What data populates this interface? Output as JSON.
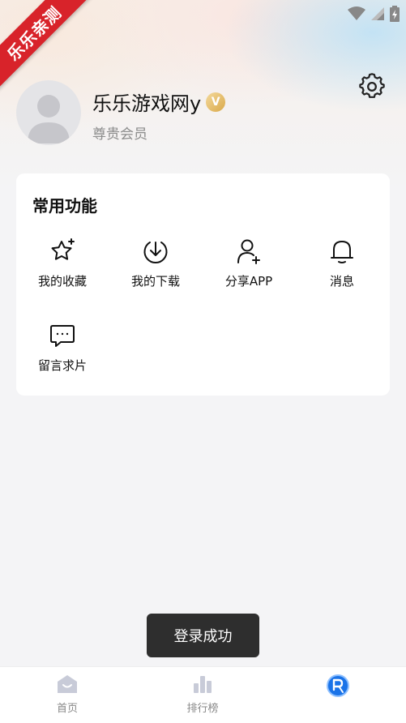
{
  "ribbon": {
    "text": "乐乐亲测"
  },
  "profile": {
    "username": "乐乐游戏网y",
    "member_level": "尊贵会员",
    "vip_badge": "V"
  },
  "functions": {
    "title": "常用功能",
    "items": [
      {
        "label": "我的收藏",
        "icon": "star-plus-icon"
      },
      {
        "label": "我的下载",
        "icon": "download-icon"
      },
      {
        "label": "分享APP",
        "icon": "add-user-icon"
      },
      {
        "label": "消息",
        "icon": "bell-icon"
      },
      {
        "label": "留言求片",
        "icon": "message-icon"
      }
    ]
  },
  "toast": {
    "text": "登录成功"
  },
  "tabbar": {
    "items": [
      {
        "label": "首页",
        "icon": "home-icon"
      },
      {
        "label": "排行榜",
        "icon": "chart-bar-icon"
      },
      {
        "label": "",
        "icon": "profile-logo-icon"
      }
    ],
    "accent": "#1a73e8"
  },
  "colors": {
    "ribbon": "#d8232a",
    "background": "#f4f4f6",
    "card": "#ffffff"
  }
}
